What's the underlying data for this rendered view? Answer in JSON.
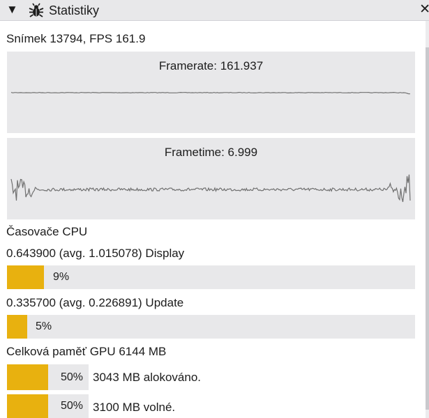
{
  "panel": {
    "title": "Statistiky",
    "collapse_icon": "triangle-down-icon",
    "title_icon": "bug-icon",
    "close_icon": "close-icon"
  },
  "frame_info": "Snímek 13794, FPS 161.9",
  "framerate": {
    "label": "Framerate: 161.937",
    "series_color": "#707070"
  },
  "frametime": {
    "label": "Frametime: 6.999",
    "series_color": "#707070"
  },
  "cpu_timers": {
    "heading": "Časovače CPU",
    "items": [
      {
        "label": "0.643900 (avg. 1.015078) Display",
        "percent_text": "9%",
        "fill": 0.09
      },
      {
        "label": "0.335700 (avg. 0.226891) Update",
        "percent_text": "5%",
        "fill": 0.05
      }
    ]
  },
  "gpu_memory": {
    "heading": "Celková paměť GPU 6144 MB",
    "items": [
      {
        "percent_text": "50%",
        "fill": 0.5,
        "label": "3043 MB alokováno."
      },
      {
        "percent_text": "50%",
        "fill": 0.5,
        "label": "3100 MB volné."
      }
    ]
  },
  "colors": {
    "accent_bar": "#e8b10f",
    "panel_bg": "#e8e8ea",
    "title_bg": "#e8e8ea"
  }
}
